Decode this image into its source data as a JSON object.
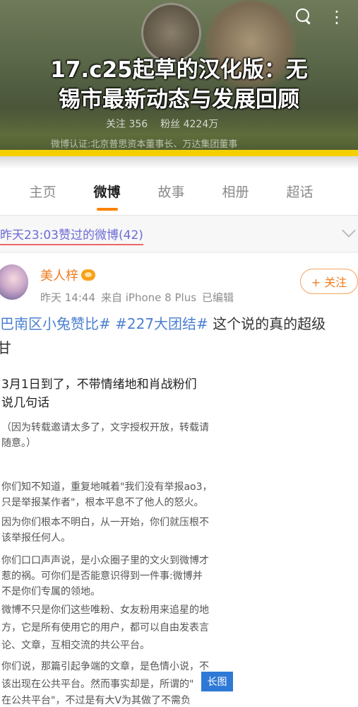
{
  "headline": {
    "line1": "17.c25起草的汉化版：无",
    "line2": "锡市最新动态与发展回顾"
  },
  "profile": {
    "stats_following": "关注 356",
    "stats_fans": "粉丝 4224万",
    "verified": "微博认证:北京普思资本董事长、万达集团董事"
  },
  "tabs": [
    {
      "label": "主页"
    },
    {
      "label": "微博"
    },
    {
      "label": "故事"
    },
    {
      "label": "相册"
    },
    {
      "label": "超话"
    }
  ],
  "liked_strip": {
    "text": "昨天23:03赞过的微博(42)"
  },
  "post": {
    "username": "美人梓",
    "time": "昨天 14:44",
    "source": "来自 iPhone 8 Plus",
    "edited": "已编辑",
    "follow_label": "+ 关注",
    "hashtag1": "巴南区小兔赞比#",
    "hashtag2": "#227大团结#",
    "hashtag_tail": " 这个说的真的超级",
    "cont": "甘",
    "lead_line1": "3月1日到了，不带情绪地和肖战粉们",
    "lead_line2": "说几句话",
    "paren_line1": "（因为转载邀请太多了，文字授权开放，转载请",
    "paren_line2": "随意。）",
    "p1_line1": "你们知不知道，重复地喊着\"我们没有举报ao3，",
    "p1_line2": "只是举报某作者\"，根本平息不了他人的怒火。",
    "p2_line1": "因为你们根本不明白，从一开始，你们就压根不",
    "p2_line2": "该举报任何人。",
    "p3_line1": "你们口口声声说，是小众圈子里的文火到微博才",
    "p3_line2": "惹的祸。可你们是否能意识得到一件事:微博并",
    "p3_line3": "不是你们专属的领地。",
    "p4_line1": "微博不只是你们这些唯粉、女友粉用来追星的地",
    "p4_line2": "方，它是所有使用它的用户，都可以自由发表言",
    "p4_line3": "论、文章，互相交流的共公平台。",
    "p5_line1": "你们说，那篇引起争端的文章，是色情小说，不",
    "p5_line2": "该出现在公共平台。然而事实却是，所谓的\"",
    "p5_line3": "在公共平台\"，不过是有大V为其做了不需负",
    "long_image_badge": "长图"
  }
}
